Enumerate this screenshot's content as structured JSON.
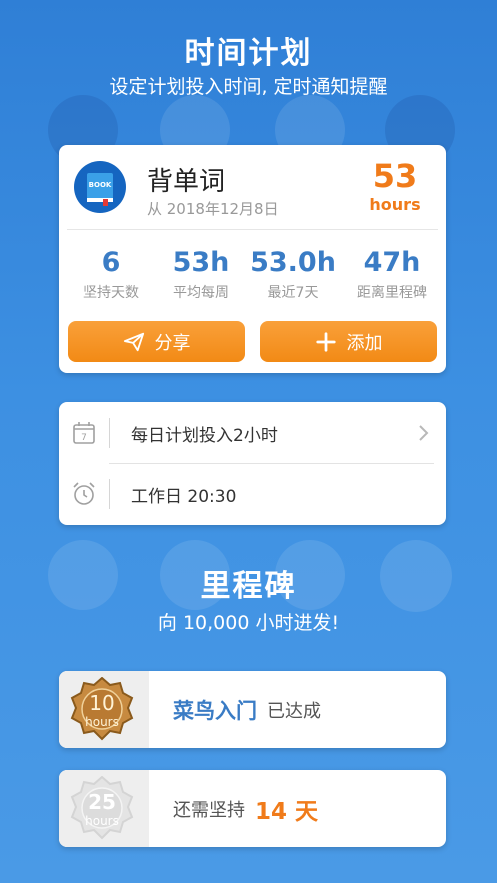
{
  "hero": {
    "title": "时间计划",
    "subtitle": "设定计划投入时间, 定时通知提醒"
  },
  "habit": {
    "icon_text": "BOOK",
    "title": "背单词",
    "since": "从 2018年12月8日",
    "total_hours": "53",
    "hours_unit": "hours"
  },
  "stats": [
    {
      "value": "6",
      "label": "坚持天数"
    },
    {
      "value": "53h",
      "label": "平均每周"
    },
    {
      "value": "53.0h",
      "label": "最近7天"
    },
    {
      "value": "47h",
      "label": "距离里程碑"
    }
  ],
  "actions": {
    "share_label": "分享",
    "add_label": "添加"
  },
  "plan": {
    "daily_text": "每日计划投入2小时",
    "calendar_day": "7",
    "reminder_text": "工作日 20:30"
  },
  "milestones": {
    "title": "里程碑",
    "subtitle": "向 10,000 小时进发!",
    "items": [
      {
        "badge_num": "10",
        "badge_unit": "hours",
        "name": "菜鸟入门",
        "status": "已达成"
      },
      {
        "badge_num": "25",
        "badge_unit": "hours",
        "prefix": "还需坚持",
        "remaining": "14 天"
      }
    ]
  },
  "colors": {
    "accent_orange": "#f07b1a",
    "stat_blue": "#3a7cc5",
    "background_blue": "#3d90e2"
  }
}
